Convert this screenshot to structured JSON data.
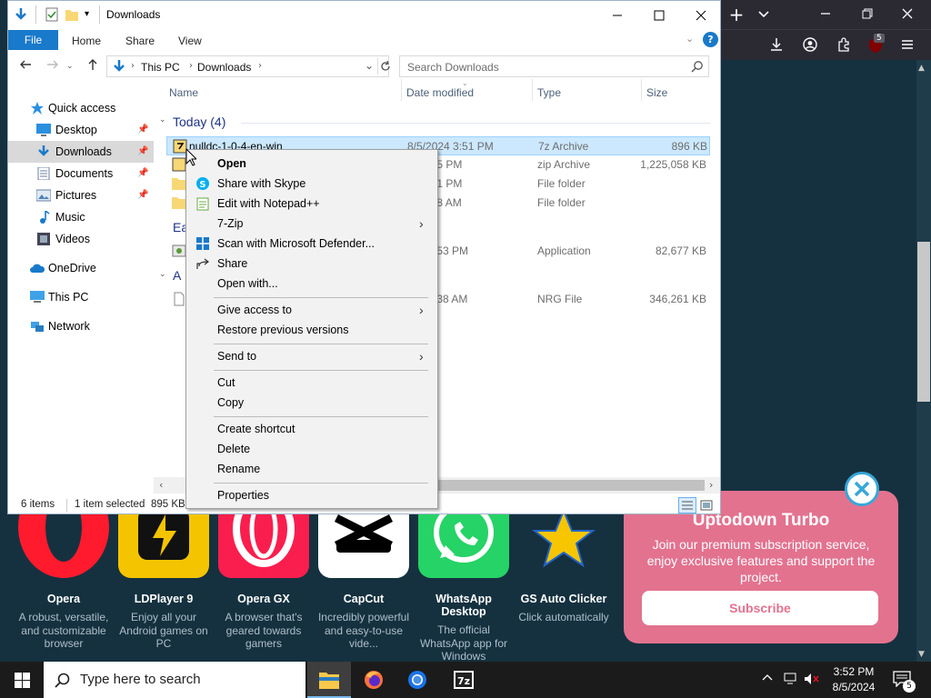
{
  "browser": {
    "tab_add": "+",
    "badge_count": "5"
  },
  "apps": [
    {
      "name": "Opera",
      "desc": "A robust, versatile, and customizable browser",
      "color": "#ffffff"
    },
    {
      "name": "LDPlayer 9",
      "desc": "Enjoy all your Android games on PC",
      "color": "#f5c400"
    },
    {
      "name": "Opera GX",
      "desc": "A browser that's geared towards gamers",
      "color": "#ffffff"
    },
    {
      "name": "CapCut",
      "desc": "Incredibly powerful and easy-to-use vide...",
      "color": "#ffffff"
    },
    {
      "name": "WhatsApp Desktop",
      "desc": "The official WhatsApp app for Windows",
      "color": "#25d366"
    },
    {
      "name": "GS Auto Clicker",
      "desc": "Click automatically",
      "color": "#15313f"
    }
  ],
  "promo": {
    "title": "Uptodown Turbo",
    "text": "Join our premium subscription service, enjoy exclusive features and support the project.",
    "button": "Subscribe"
  },
  "explorer": {
    "title": "Downloads",
    "ribbon_tabs": [
      "File",
      "Home",
      "Share",
      "View"
    ],
    "help": "?",
    "breadcrumb": [
      "This PC",
      "Downloads"
    ],
    "search_placeholder": "Search Downloads",
    "sidebar": [
      {
        "label": "Quick access",
        "icon": "star-icon"
      },
      {
        "label": "Desktop",
        "icon": "desktop-icon"
      },
      {
        "label": "Downloads",
        "icon": "download-icon"
      },
      {
        "label": "Documents",
        "icon": "documents-icon"
      },
      {
        "label": "Pictures",
        "icon": "pictures-icon"
      },
      {
        "label": "Music",
        "icon": "music-icon"
      },
      {
        "label": "Videos",
        "icon": "videos-icon"
      },
      {
        "label": "OneDrive",
        "icon": "cloud-icon"
      },
      {
        "label": "This PC",
        "icon": "computer-icon"
      },
      {
        "label": "Network",
        "icon": "network-icon"
      }
    ],
    "columns": [
      "Name",
      "Date modified",
      "Type",
      "Size"
    ],
    "groups": [
      "Today (4)",
      "Ea",
      "A"
    ],
    "files": [
      {
        "name": "nulldc-1-0-4-en-win",
        "date": "8/5/2024 3:51 PM",
        "type": "7z Archive",
        "size": "896 KB"
      },
      {
        "name": "",
        "date": "24 3:25 PM",
        "type": "zip Archive",
        "size": "1,225,058 KB"
      },
      {
        "name": "",
        "date": "24 3:51 PM",
        "type": "File folder",
        "size": ""
      },
      {
        "name": "",
        "date": "24 8:28 AM",
        "type": "File folder",
        "size": ""
      },
      {
        "name": "",
        "date": "024 3:53 PM",
        "type": "Application",
        "size": "82,677 KB"
      },
      {
        "name": "",
        "date": "306 8:38 AM",
        "type": "NRG File",
        "size": "346,261 KB"
      }
    ],
    "status": {
      "items": "6 items",
      "selected": "1 item selected",
      "size": "895 KB"
    }
  },
  "context_menu": {
    "items": [
      "Open",
      "Share with Skype",
      "Edit with Notepad++",
      "7-Zip",
      "Scan with Microsoft Defender...",
      "Share",
      "Open with...",
      "Give access to",
      "Restore previous versions",
      "Send to",
      "Cut",
      "Copy",
      "Create shortcut",
      "Delete",
      "Rename",
      "Properties"
    ]
  },
  "taskbar": {
    "search_placeholder": "Type here to search",
    "time": "3:52 PM",
    "date": "8/5/2024",
    "notification_count": "5"
  },
  "colors": {
    "accent": "#1979ca",
    "selection": "#cce8ff",
    "promo": "#e3728f"
  }
}
